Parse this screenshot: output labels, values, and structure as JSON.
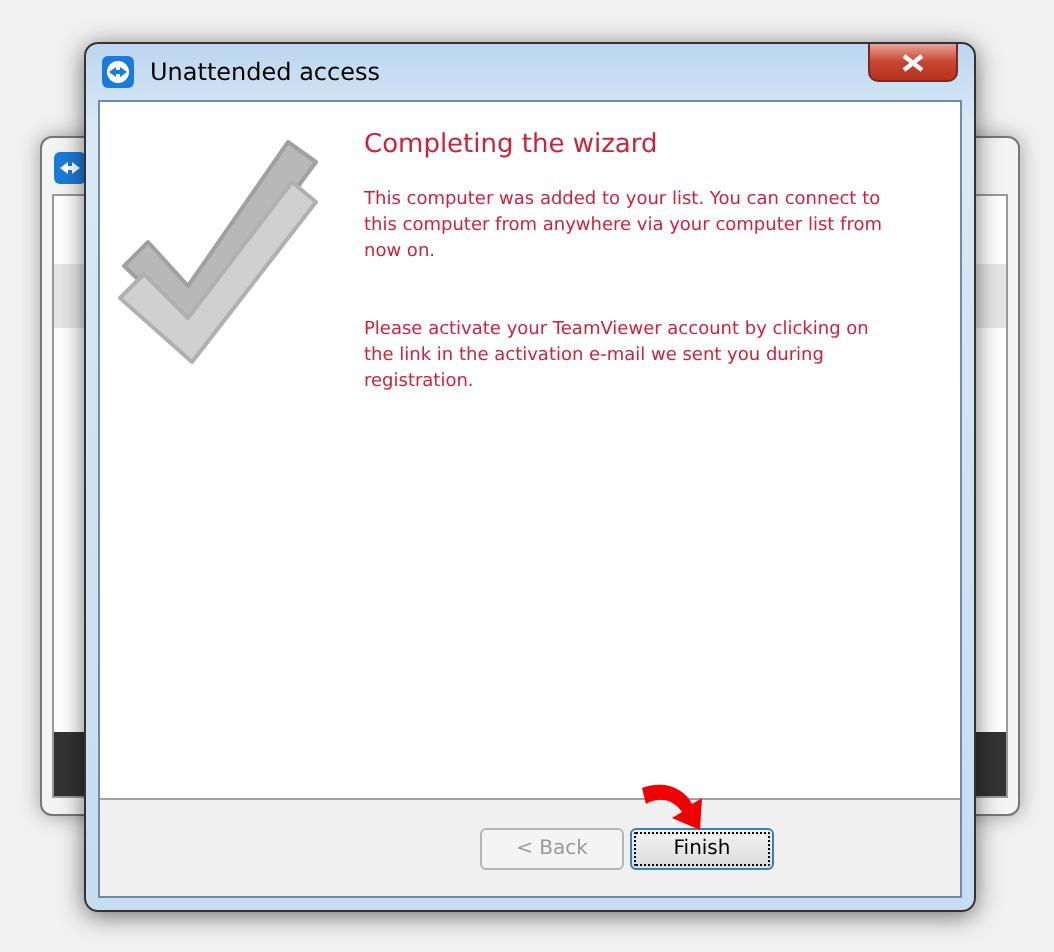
{
  "window": {
    "title": "Unattended access"
  },
  "heading": "Completing the wizard",
  "paragraphs": [
    "This computer was added to your list. You can connect to this computer from anywhere via your computer list from now on.",
    "Please activate your TeamViewer account by clicking on the link in the activation e-mail we sent you during registration."
  ],
  "buttons": [
    {
      "label": "< Back",
      "disabled": true,
      "focused": false
    },
    {
      "label": "Finish",
      "disabled": false,
      "focused": true
    }
  ]
}
